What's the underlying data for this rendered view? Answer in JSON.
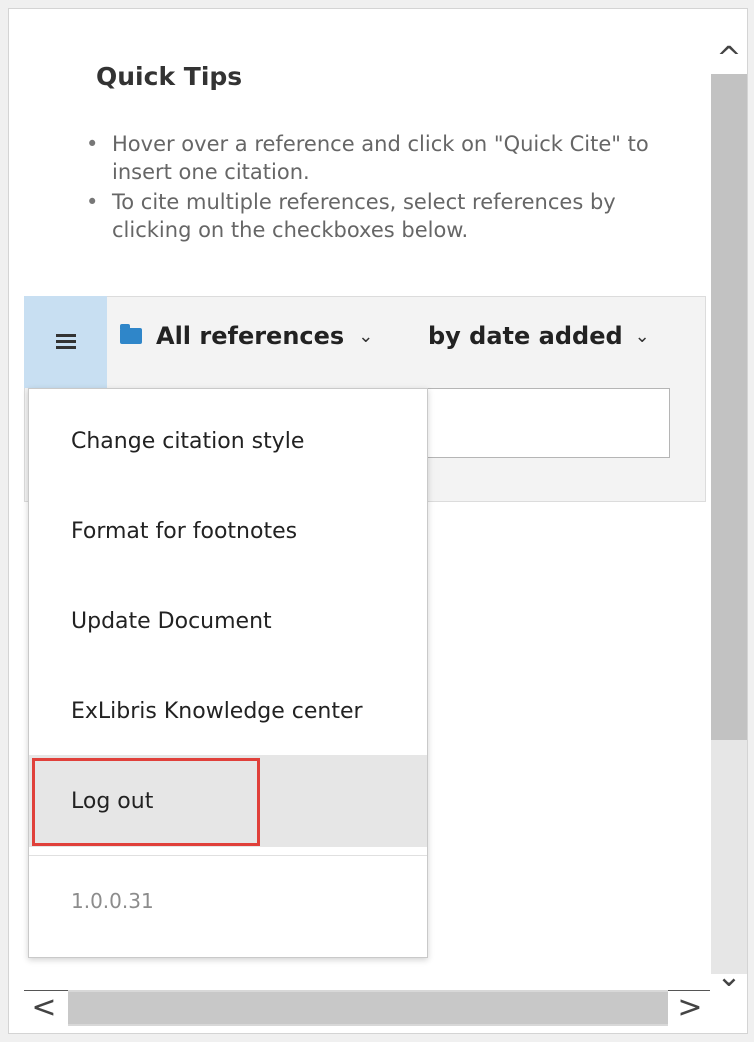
{
  "tips": {
    "title": "Quick Tips",
    "items": [
      "Hover over a reference and click on \"Quick Cite\" to insert one citation.",
      "To cite multiple references, select references by clicking on the checkboxes below."
    ]
  },
  "toolbar": {
    "menu_icon": "hamburger-icon",
    "folder_icon": "folder-icon",
    "folder_label": "All references",
    "sort_label": "by date added",
    "chevron": "⌄",
    "search_value": ""
  },
  "menu": {
    "items": [
      "Change citation style",
      "Format for footnotes",
      "Update Document",
      "ExLibris Knowledge center",
      "Log out"
    ],
    "version": "1.0.0.31"
  },
  "scroll": {
    "up": "^",
    "down": "⌄",
    "left": "<",
    "right": ">"
  },
  "colors": {
    "menu_button_bg": "#c8dff2",
    "folder_blue": "#2f86c9",
    "highlight_red": "#e0403a"
  }
}
